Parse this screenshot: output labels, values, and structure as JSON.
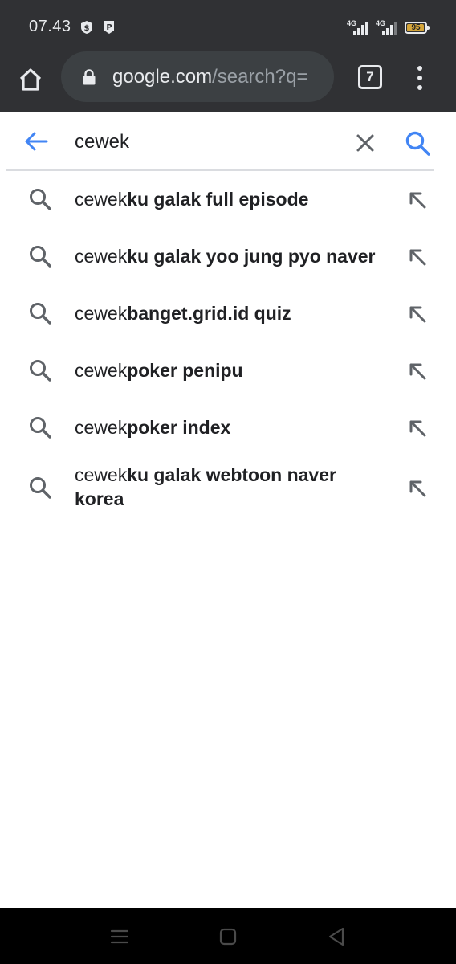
{
  "status_bar": {
    "time": "07.43",
    "network1": "4G",
    "network2": "4G",
    "battery": "95",
    "battery_level": 0.95,
    "notification_icons": [
      "shield-dollar-icon",
      "p-badge-icon"
    ]
  },
  "toolbar": {
    "url_domain": "google.com",
    "url_path": "/search?q=",
    "tab_count": "7"
  },
  "search": {
    "query": "cewek"
  },
  "suggestions": [
    {
      "prefix": "cewek",
      "completion": "ku galak full episode"
    },
    {
      "prefix": "cewek",
      "completion": "ku galak yoo jung pyo naver"
    },
    {
      "prefix": "cewek",
      "completion": "banget.grid.id quiz"
    },
    {
      "prefix": "cewek",
      "completion": "poker penipu"
    },
    {
      "prefix": "cewek",
      "completion": "poker index"
    },
    {
      "prefix": "cewek",
      "completion": "ku galak webtoon naver korea"
    }
  ],
  "colors": {
    "accent": "#4285f4",
    "chrome_dark": "#303134",
    "omnibox": "#3c4043",
    "text": "#202124",
    "icon_grey": "#5f6368"
  }
}
